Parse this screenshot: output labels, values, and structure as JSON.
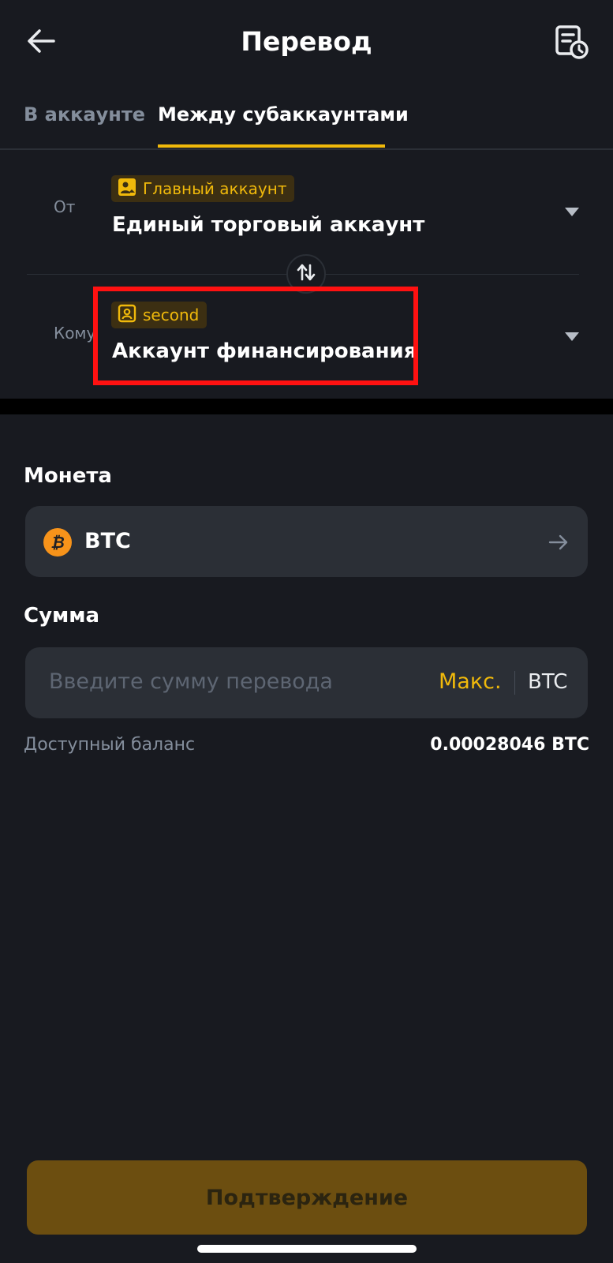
{
  "header": {
    "title": "Перевод"
  },
  "tabs": [
    {
      "label": "В аккаунте",
      "active": false
    },
    {
      "label": "Между субаккаунтами",
      "active": true
    }
  ],
  "transfer": {
    "from": {
      "label": "От",
      "tag": "Главный аккаунт",
      "account": "Единый торговый аккаунт"
    },
    "to": {
      "label": "Кому",
      "tag": "second",
      "account": "Аккаунт финансирования"
    }
  },
  "coin": {
    "section_label": "Монета",
    "symbol": "BTC",
    "icon_glyph": "₿"
  },
  "amount": {
    "section_label": "Сумма",
    "placeholder": "Введите сумму перевода",
    "max_label": "Макс.",
    "unit": "BTC",
    "available_label": "Доступный баланс",
    "available_value": "0.00028046 BTC"
  },
  "confirm_label": "Подтверждение",
  "colors": {
    "background": "#181a20",
    "accent": "#f0b90b",
    "card": "#2b2f36",
    "highlight": "#ff1111",
    "confirm_button": "#6c4e10"
  }
}
